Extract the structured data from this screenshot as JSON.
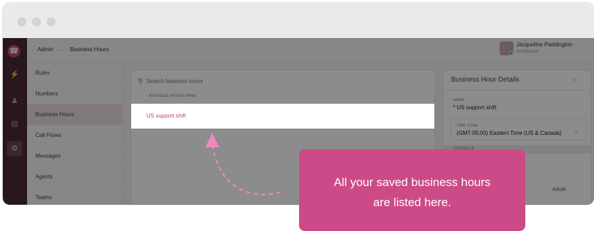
{
  "window": {
    "dots": [
      "#d3d3d3",
      "#d3d3d3",
      "#d3d3d3"
    ]
  },
  "rail": {
    "logo_icon": "phone-icon",
    "icons": [
      "bolt-icon",
      "people-icon",
      "card-icon",
      "gear-icon"
    ],
    "active_icon": "gear-icon",
    "color": "#4a2a39",
    "accent": "#c54a7f"
  },
  "topbar": {
    "breadcrumb": [
      "Admin",
      "Business Hours"
    ],
    "separator": "→",
    "user": {
      "name": "Jacqueline Paddington",
      "status": "ON BREAKS",
      "status_color": "#5cb85c"
    }
  },
  "subnav": {
    "items": [
      "Rules",
      "Numbers",
      "Business Hours",
      "Call Flows",
      "Messages",
      "Agents",
      "Teams"
    ],
    "active": "Business Hours"
  },
  "list": {
    "search_placeholder": "Search business hours",
    "column_header": "BUSINESS HOURS NAME",
    "rows": [
      "US support shift"
    ],
    "row_color": "#c2407a"
  },
  "details": {
    "title": "Business Hour Details",
    "close": "×",
    "name_label": "NAME",
    "name_value": "* US support shift",
    "timezone_label": "TIME ZONE",
    "timezone_value": "(GMT-05:00) Eastern Time (US & Canada)",
    "schedule_label": "SCHEDULE",
    "partial_text": "edule"
  },
  "tooltip": {
    "line1": "All your saved business hours",
    "line2": "are listed here.",
    "color": "#cc4a87"
  }
}
